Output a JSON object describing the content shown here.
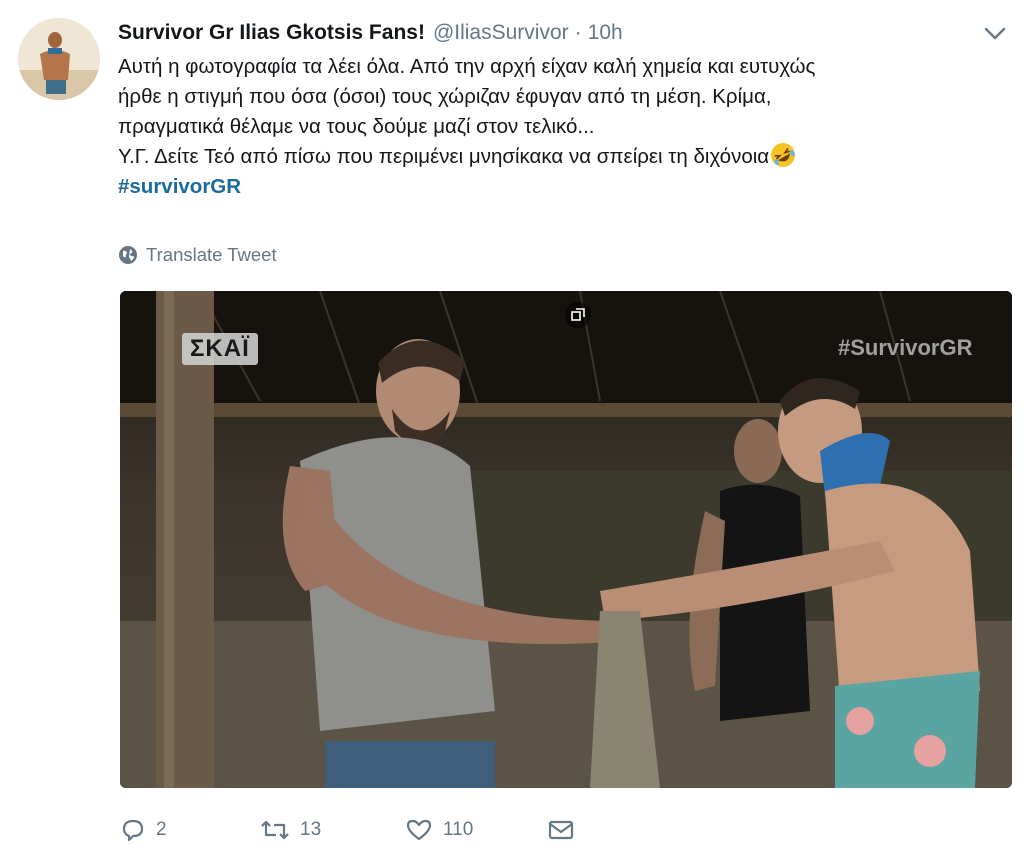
{
  "tweet": {
    "author_name": "Survivor Gr Ilias Gkotsis Fans!",
    "handle": "@IliasSurvivor",
    "separator": "·",
    "time": "10h",
    "text_lines": [
      "Αυτή η φωτογραφία τα λέει όλα. Από την αρχή είχαν καλή χημεία και ευτυχώς",
      "ήρθε η στιγμή που όσα (όσοι) τους χώριζαν έφυγαν από τη μέση. Κρίμα,",
      "πραγματικά θέλαμε να τους δούμε μαζί στον τελικό...",
      "Υ.Γ. Δείτε Τεό από πίσω που περιμένει μνησίκακα να σπείρει τη διχόνοια"
    ],
    "hashtag": "#survivorGR",
    "emoji_icon": "rolling-on-floor-laughing-emoji",
    "translate_label": "Translate Tweet"
  },
  "media": {
    "channel_logo": "ΣΚΑΪ",
    "watermark": "#SurvivorGR",
    "gif_icon": "media-badge-icon"
  },
  "actions": {
    "reply_count": "2",
    "retweet_count": "13",
    "like_count": "110"
  },
  "colors": {
    "text": "#14171a",
    "muted": "#657786",
    "hashtag": "#1b6a9e"
  }
}
